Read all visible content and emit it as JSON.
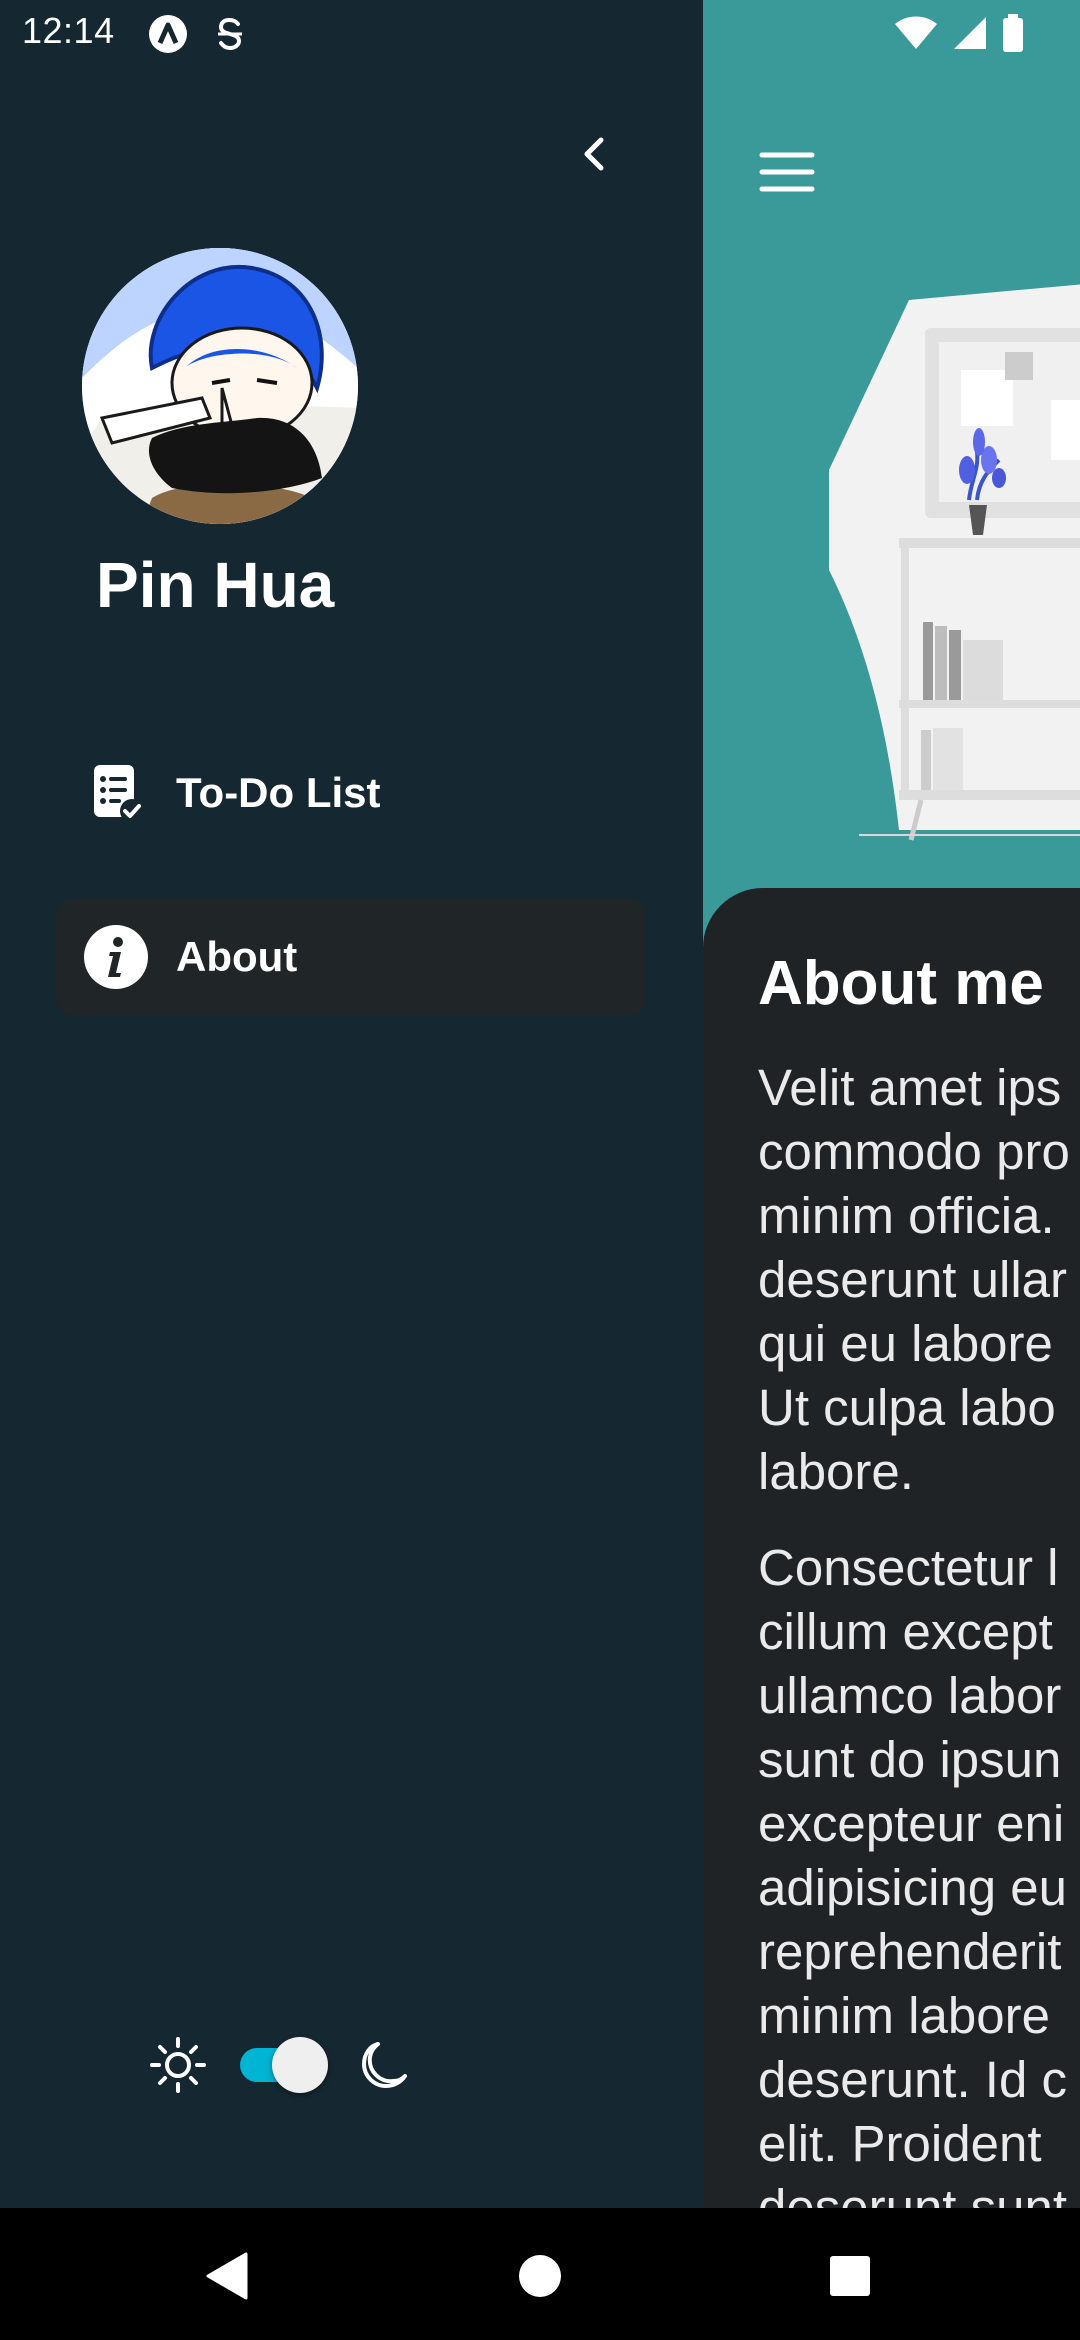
{
  "status_bar": {
    "time": "12:14",
    "left_icons": [
      "app-a-icon",
      "app-s-icon"
    ],
    "right_icons": [
      "wifi-icon",
      "signal-icon",
      "battery-icon"
    ]
  },
  "drawer": {
    "profile_name": "Pin Hua",
    "nav_items": [
      {
        "label": "To-Do List",
        "icon": "todo-list-icon",
        "active": false
      },
      {
        "label": "About",
        "icon": "info-icon",
        "active": true
      }
    ],
    "theme": {
      "light_icon": "sun-icon",
      "dark_icon": "moon-icon",
      "dark_mode_on": true,
      "toggle_color": "#00b4d4"
    },
    "colors": {
      "background": "#152731",
      "active_item": "#202528"
    }
  },
  "main": {
    "header_color": "#3a9999",
    "card_color": "#1f2326",
    "title": "About me",
    "paragraph1_lines": [
      "Velit amet ips",
      "commodo pro",
      "minim officia.",
      "deserunt ullar",
      "qui eu labore",
      "Ut culpa labo",
      "labore."
    ],
    "paragraph2_lines": [
      "Consectetur l",
      "cillum except",
      "ullamco labor",
      "sunt do ipsun",
      "excepteur eni",
      "adipisicing eu",
      "reprehenderit",
      "minim labore",
      "deserunt. Id c",
      "elit. Proident",
      "deserunt sunt"
    ]
  },
  "nav_bar": {
    "buttons": [
      "back-triangle-icon",
      "home-circle-icon",
      "recents-square-icon"
    ]
  }
}
